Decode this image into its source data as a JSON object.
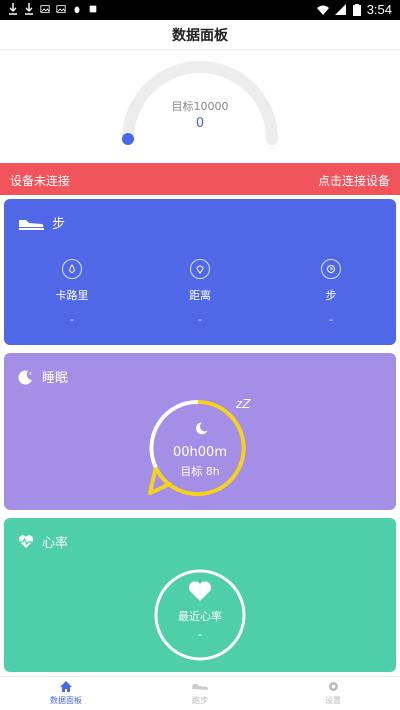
{
  "status_bar": {
    "time": "3:54"
  },
  "header": {
    "title": "数据面板"
  },
  "gauge": {
    "target_label": "目标10000",
    "value": "0",
    "progress": 0
  },
  "alert": {
    "left_text": "设备未连接",
    "right_text": "点击连接设备"
  },
  "steps_card": {
    "title": "步",
    "metrics": [
      {
        "label": "卡路里",
        "value": "-"
      },
      {
        "label": "距离",
        "value": "-"
      },
      {
        "label": "步",
        "value": "-"
      }
    ]
  },
  "sleep_card": {
    "title": "睡眠",
    "time": "00h00m",
    "goal": "目标 8h",
    "zz": "zZ"
  },
  "heart_card": {
    "title": "心率",
    "label": "最近心率",
    "value": "-"
  },
  "tabs": [
    {
      "label": "数据面板"
    },
    {
      "label": "跑步"
    },
    {
      "label": "设置"
    }
  ],
  "colors": {
    "steps": "#5068e8",
    "sleep": "#a58fe6",
    "heart": "#4ecfaa",
    "alert": "#f2545b",
    "accent": "#4a66e6",
    "sleep_ring": "#f5d31c"
  }
}
